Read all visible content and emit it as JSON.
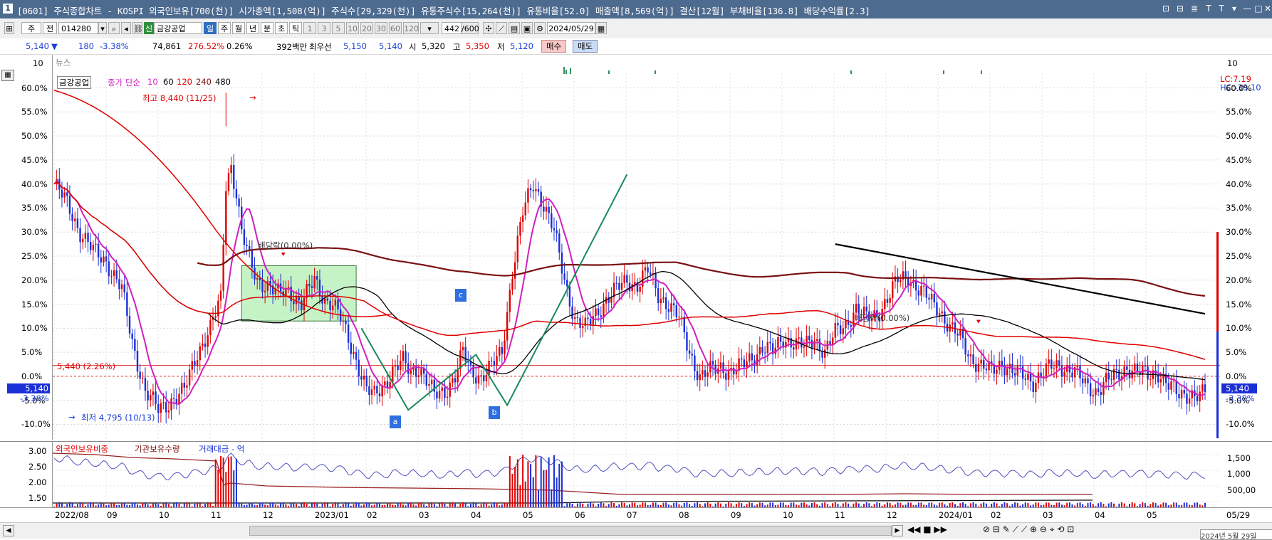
{
  "window": {
    "badge": "1",
    "title": "[0601] 주식종합차트 - KOSPI 외국인보유[700(천)] 시가총액[1,508(억)] 주식수[29,329(천)] 유통주식수[15,264(천)] 유통비율[52.0] 매출액[8,569(억)] 결산[12월] 부채비율[136.8] 배당수익률[2.3]",
    "controls": [
      "⊡",
      "⊟",
      "≣",
      "T",
      "T",
      "▾",
      "—",
      "□",
      "✕"
    ]
  },
  "toolbar": {
    "market": "주",
    "market2": "전",
    "code": "014280",
    "stock_tag": "신",
    "stock_name": "금강공업",
    "periods": [
      "일",
      "주",
      "월",
      "년",
      "분",
      "초",
      "틱"
    ],
    "active_period": "일",
    "intervals": [
      "1",
      "3",
      "5",
      "10",
      "20",
      "30",
      "60",
      "120"
    ],
    "count": "442",
    "count_max": "/600",
    "date": "2024/05/29"
  },
  "quote": {
    "price": "5,140",
    "change": "180",
    "change_pct": "-3.38%",
    "volume": "74,861",
    "vol_ratio": "276.52%",
    "turnover": "0.26%",
    "amount": "392백만",
    "best_label": "최우선",
    "best_ask": "5,150",
    "best_bid": "5,140",
    "open_label": "시",
    "open": "5,320",
    "high_label": "고",
    "high": "5,350",
    "low_label": "저",
    "low": "5,120",
    "buy": "매수",
    "sell": "매도"
  },
  "news_pane": {
    "label": "뉴스",
    "tick": "10"
  },
  "price_pane": {
    "legend_name": "금강공업",
    "legend_ma": "종가 단순",
    "ma_periods": [
      "10",
      "60",
      "120",
      "240",
      "480"
    ],
    "lc": "LC:7.19",
    "hc": "HC:-39.10",
    "ref_label": "5,440 (2.26%)",
    "cur_price": "5,140",
    "cur_pct": "-3.38%",
    "high_note": "최고 8,440 (11/25)",
    "low_note": "최저 4,795 (10/13)",
    "div1": "배당락(0.00%)",
    "div2": "배당락(0.00%)",
    "wave_a": "a",
    "wave_b": "b",
    "wave_c": "c"
  },
  "lower_pane": {
    "leg1": "외국인보유비중",
    "leg2": "기관보유수량",
    "leg3": "거래대금 - 억",
    "left_ticks": [
      "3.00",
      "2.50",
      "2.00",
      "1.50"
    ],
    "right_ticks": [
      "1,500",
      "1,000",
      "500,00"
    ]
  },
  "date_axis": [
    "2022/08",
    "09",
    "10",
    "11",
    "12",
    "2023/01",
    "02",
    "03",
    "04",
    "05",
    "06",
    "07",
    "08",
    "09",
    "10",
    "11",
    "12",
    "2024/01",
    "02",
    "03",
    "04",
    "05"
  ],
  "date_end": "05/29",
  "status_time": "2024년 5월 29일",
  "colors": {
    "ma10": "#d020c0",
    "ma60": "#000000",
    "ma120": "#e00000",
    "ma240": "#7a1010",
    "up": "#e00000",
    "down": "#1a2fd6",
    "wave": "#1a8a5a",
    "box": "#b8f0b8"
  },
  "chart_data": {
    "type": "line",
    "yaxis_pct_ticks": [
      "60.0%",
      "55.0%",
      "50.0%",
      "45.0%",
      "40.0%",
      "35.0%",
      "30.0%",
      "25.0%",
      "20.0%",
      "15.0%",
      "10.0%",
      "5.0%",
      "0.0%",
      "-5.0%",
      "-10.0%"
    ],
    "y_range_pct": [
      -12,
      62
    ],
    "series": [
      {
        "name": "종가",
        "x": [
          0,
          5,
          10,
          15,
          20,
          26,
          30,
          35,
          40,
          45,
          50,
          55,
          60,
          64,
          66,
          68,
          70,
          72,
          75,
          78,
          82,
          86,
          90,
          95,
          100,
          104,
          107,
          110,
          115,
          120,
          123,
          126,
          130,
          134,
          137,
          140,
          143,
          146,
          150,
          154,
          157,
          160,
          164,
          168,
          172,
          176,
          180,
          184,
          188,
          192,
          196,
          200,
          204,
          208,
          212,
          216,
          220,
          224,
          228,
          232,
          236,
          240,
          244,
          248,
          252,
          256,
          260,
          264,
          268,
          272,
          276,
          280,
          284,
          288,
          292,
          296,
          300,
          304,
          308,
          312,
          316,
          320,
          324,
          328,
          332,
          336,
          340,
          344,
          348,
          352,
          356,
          360,
          364,
          368,
          372,
          376,
          380,
          384,
          388,
          392,
          396,
          400,
          404,
          408,
          412,
          416,
          420,
          424,
          428,
          432,
          436,
          440,
          442
        ],
        "y": [
          40,
          36,
          30,
          26,
          24,
          18,
          7,
          -3,
          -7,
          -5,
          -3,
          5,
          10,
          16,
          40,
          44,
          38,
          30,
          24,
          20,
          19,
          17,
          18,
          15,
          20,
          16,
          15,
          12,
          5,
          -3,
          -4,
          -2,
          1,
          3,
          1,
          2,
          -1,
          -4,
          -3,
          0,
          5,
          1,
          0,
          2,
          5,
          22,
          34,
          40,
          36,
          30,
          20,
          12,
          10,
          13,
          16,
          18,
          20,
          19,
          22,
          17,
          15,
          12,
          5,
          0,
          1,
          2,
          1,
          2,
          4,
          6,
          5,
          8,
          7,
          6,
          8,
          5,
          9,
          11,
          14,
          12,
          13,
          16,
          20,
          21,
          18,
          16,
          14,
          10,
          8,
          4,
          2,
          1,
          3,
          1,
          0,
          -1,
          1,
          2,
          2,
          1,
          -2,
          -3,
          -1,
          0,
          2,
          1,
          0,
          1,
          -2,
          -4,
          -3.4,
          -4.2,
          -3.4
        ]
      }
    ]
  }
}
